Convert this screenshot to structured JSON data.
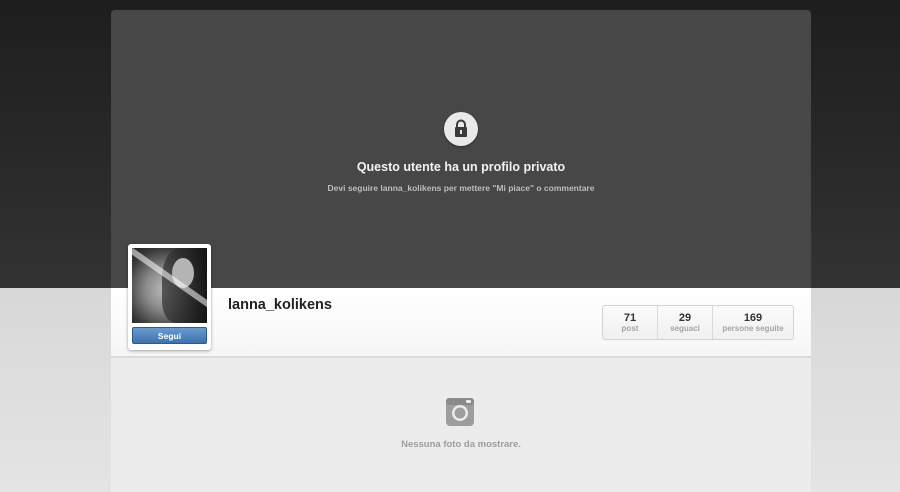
{
  "private_notice": {
    "title": "Questo utente ha un profilo privato",
    "subtitle": "Devi seguire lanna_kolikens per mettere \"Mi piace\" o commentare",
    "icon": "lock-icon"
  },
  "profile": {
    "username": "lanna_kolikens",
    "follow_label": "Segui",
    "stats": [
      {
        "value": "71",
        "label": "post"
      },
      {
        "value": "29",
        "label": "seguaci"
      },
      {
        "value": "169",
        "label": "persone seguite"
      }
    ]
  },
  "empty_state": {
    "text": "Nessuna foto da mostrare.",
    "icon": "camera-icon"
  },
  "colors": {
    "cover": "#474747",
    "follow_button": "#3d72ac",
    "background_dark": "#2a2a2a",
    "background_light": "#dcdcdc"
  }
}
